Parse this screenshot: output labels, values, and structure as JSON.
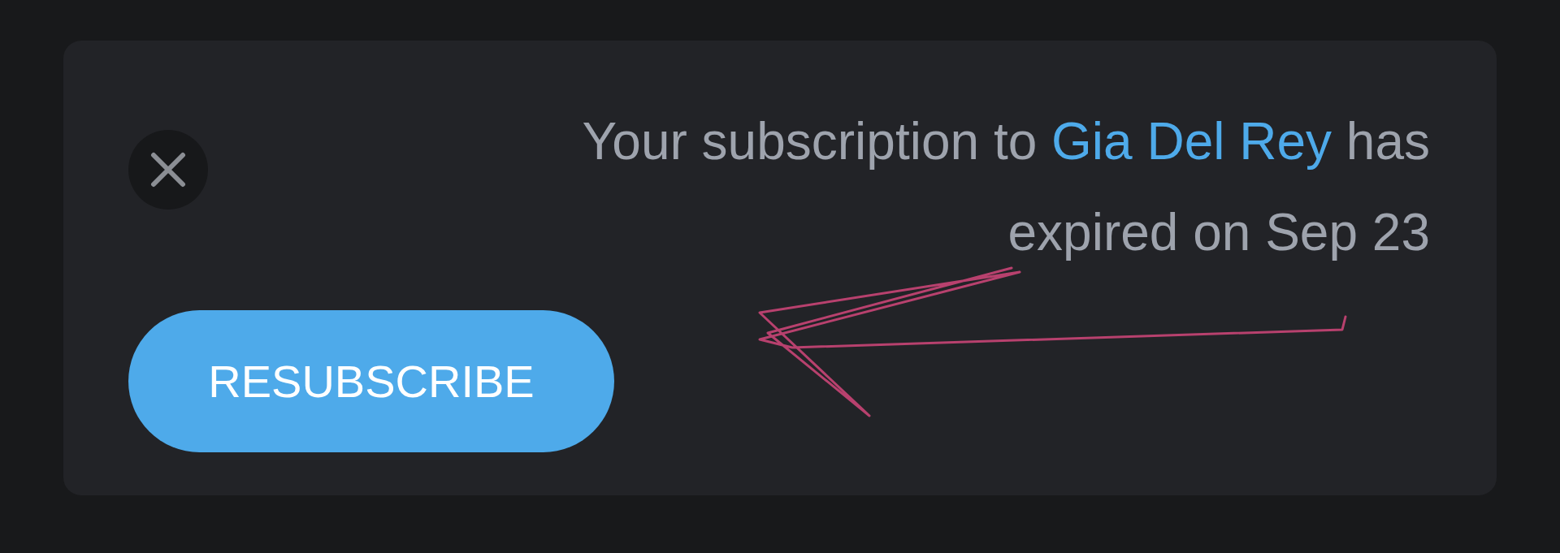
{
  "notice": {
    "message": {
      "before": "Your subscription to ",
      "link": "Gia Del Rey",
      "after": " has expired on Sep 23"
    },
    "button": "RESUBSCRIBE"
  }
}
